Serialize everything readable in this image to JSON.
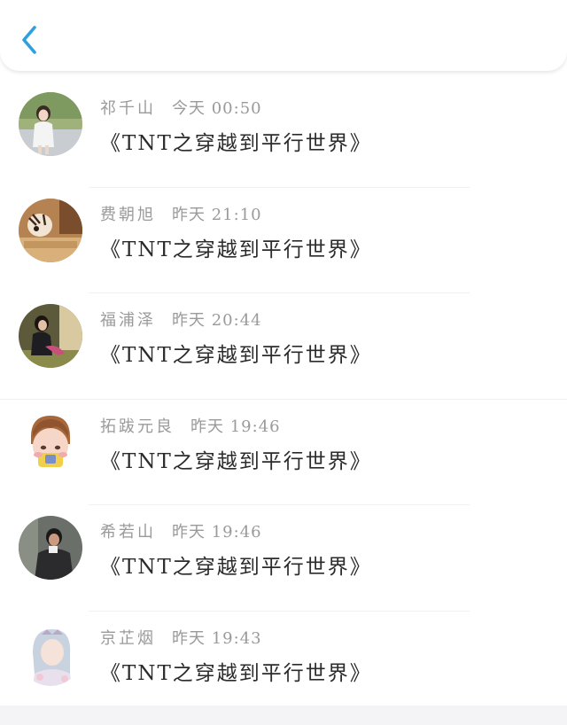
{
  "header": {
    "back_icon": "chevron-left-icon",
    "accent_color": "#2f9fe0"
  },
  "messages": [
    {
      "name": "祁千山",
      "time": "今天 00:50",
      "text": "《TNT之穿越到平行世界》"
    },
    {
      "name": "费朝旭",
      "time": "昨天 21:10",
      "text": "《TNT之穿越到平行世界》"
    },
    {
      "name": "福浦泽",
      "time": "昨天 20:44",
      "text": "《TNT之穿越到平行世界》"
    },
    {
      "name": "拓跋元良",
      "time": "昨天 19:46",
      "text": "《TNT之穿越到平行世界》"
    },
    {
      "name": "希若山",
      "time": "昨天 19:46",
      "text": "《TNT之穿越到平行世界》"
    },
    {
      "name": "京芷烟",
      "time": "昨天 19:43",
      "text": "《TNT之穿越到平行世界》"
    }
  ]
}
